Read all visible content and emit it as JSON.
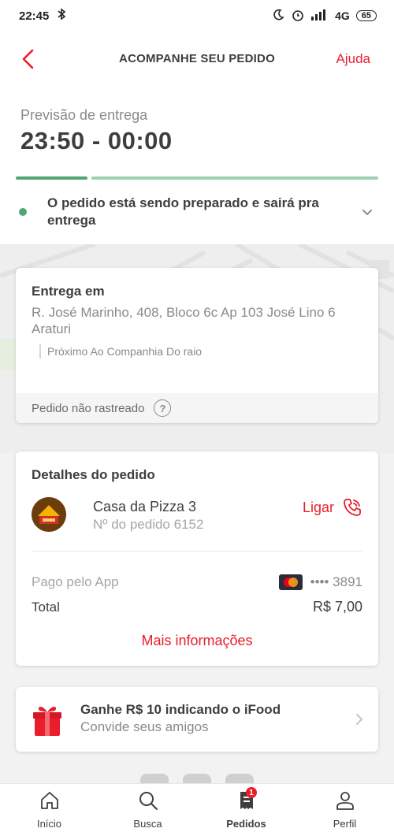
{
  "status_bar": {
    "time": "22:45",
    "network": "4G",
    "battery": "65"
  },
  "header": {
    "title": "ACOMPANHE SEU PEDIDO",
    "help": "Ajuda"
  },
  "eta": {
    "label": "Previsão de entrega",
    "value": "23:50 - 00:00"
  },
  "order_status": {
    "text": "O pedido está sendo preparado e sairá pra entrega",
    "progress_steps_completed": 1,
    "progress_steps_total": 2
  },
  "delivery": {
    "title": "Entrega em",
    "address_line1": "R. José Marinho, 408, Bloco 6c Ap 103 José Lino 6",
    "address_line2": "Araturi",
    "reference": "Próximo Ao Companhia Do raio",
    "tracking": "Pedido não rastreado",
    "tracking_help": "?"
  },
  "details": {
    "title": "Detalhes do pedido",
    "store_name": "Casa da Pizza 3",
    "order_number": "Nº do pedido 6152",
    "call": "Ligar",
    "payment_label": "Pago pelo App",
    "card_masked": "•••• 3891",
    "total_label": "Total",
    "total_value": "R$ 7,00",
    "more_info": "Mais informações"
  },
  "referral": {
    "title": "Ganhe R$ 10 indicando o iFood",
    "subtitle": "Convide seus amigos"
  },
  "nav": {
    "items": [
      {
        "label": "Início",
        "icon": "home-icon"
      },
      {
        "label": "Busca",
        "icon": "search-icon"
      },
      {
        "label": "Pedidos",
        "icon": "orders-icon",
        "badge": "1"
      },
      {
        "label": "Perfil",
        "icon": "profile-icon"
      }
    ],
    "active_index": 2
  },
  "colors": {
    "brand": "#ea1d2c",
    "progress": "#50a773",
    "progress_light": "#9ed0b3"
  }
}
